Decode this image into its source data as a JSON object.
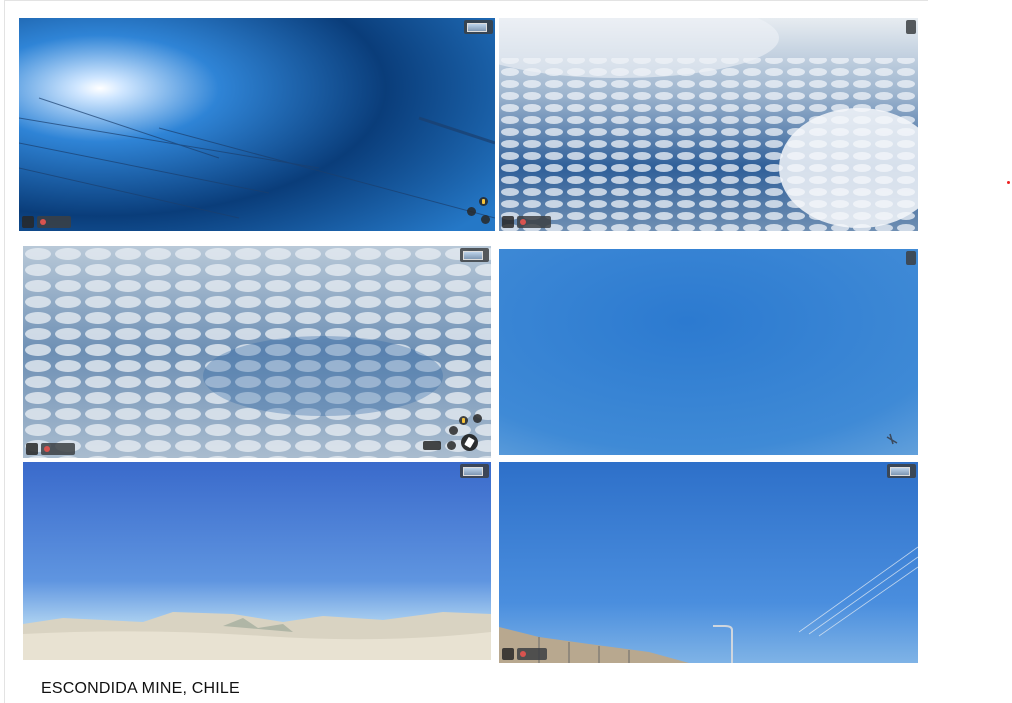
{
  "caption": "ESCONDIDA MINE, CHILE",
  "panels": [
    {
      "name": "sky-sun-power-lines",
      "colors": {
        "top": "#0a3d7a",
        "bottom": "#2f86d8"
      }
    },
    {
      "name": "sky-altocumulus",
      "colors": {
        "top": "#dfe6ee",
        "bottom": "#1f5596"
      }
    },
    {
      "name": "sky-overcast-clouds",
      "colors": {
        "top": "#c7d3df",
        "bottom": "#3a6fa6"
      }
    },
    {
      "name": "sky-clear-blue",
      "colors": {
        "top": "#2a74c8",
        "bottom": "#5aa0dc"
      }
    },
    {
      "name": "sky-desert-horizon",
      "colors": {
        "top": "#3c6fd1",
        "bottom": "#9cc7ef"
      }
    },
    {
      "name": "sky-powerlines-horizon",
      "colors": {
        "top": "#2c6fcc",
        "bottom": "#6aa9e4"
      }
    }
  ],
  "accent_marker_color": "#e22222"
}
